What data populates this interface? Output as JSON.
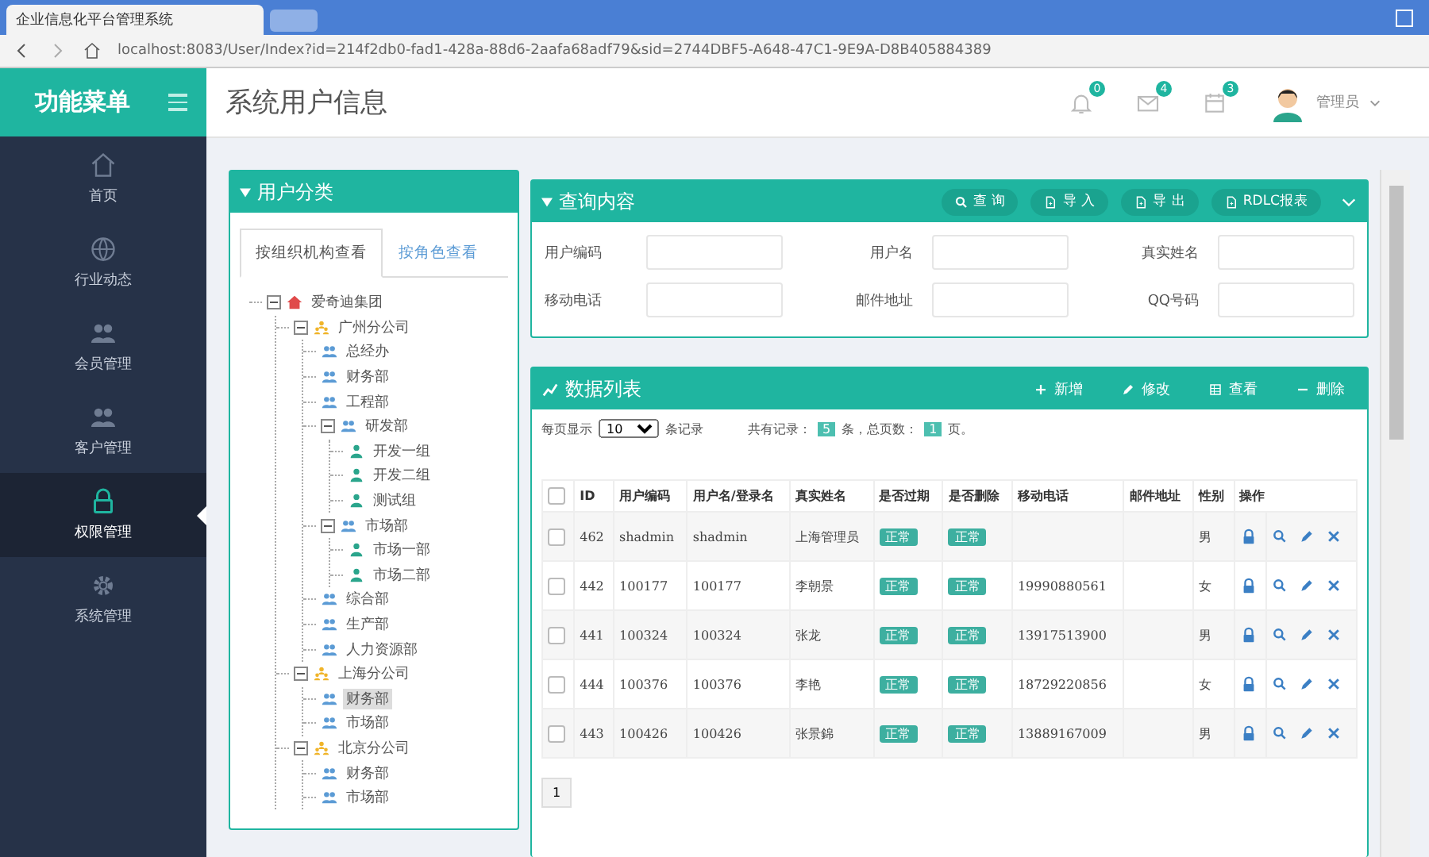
{
  "browser": {
    "tab_title": "企业信息化平台管理系统",
    "url": "localhost:8083/User/Index?id=214f2db0-fad1-428a-88d6-2aafa68adf79&sid=2744DBF5-A648-47C1-9E9A-D8B405884389"
  },
  "sidebar": {
    "title": "功能菜单",
    "items": [
      {
        "label": "首页",
        "selected": false
      },
      {
        "label": "行业动态",
        "selected": false
      },
      {
        "label": "会员管理",
        "selected": false
      },
      {
        "label": "客户管理",
        "selected": false
      },
      {
        "label": "权限管理",
        "selected": true
      },
      {
        "label": "系统管理",
        "selected": false
      }
    ]
  },
  "header": {
    "title": "系统用户信息",
    "notifications": [
      {
        "count": "0"
      },
      {
        "count": "4"
      },
      {
        "count": "3"
      }
    ],
    "user": "管理员"
  },
  "category_panel": {
    "title": "用户分类",
    "tabs": [
      {
        "label": "按组织机构查看",
        "selected": true
      },
      {
        "label": "按角色查看",
        "selected": false
      }
    ],
    "tree": [
      {
        "label": "爱奇迪集团",
        "kind": "root",
        "expanded": true,
        "selected": false,
        "children": [
          {
            "label": "广州分公司",
            "kind": "company",
            "expanded": true,
            "selected": false,
            "children": [
              {
                "label": "总经办",
                "kind": "dept",
                "selected": false
              },
              {
                "label": "财务部",
                "kind": "dept",
                "selected": false
              },
              {
                "label": "工程部",
                "kind": "dept",
                "selected": false
              },
              {
                "label": "研发部",
                "kind": "dept",
                "expanded": true,
                "selected": false,
                "children": [
                  {
                    "label": "开发一组",
                    "kind": "group",
                    "selected": false
                  },
                  {
                    "label": "开发二组",
                    "kind": "group",
                    "selected": false
                  },
                  {
                    "label": "测试组",
                    "kind": "group",
                    "selected": false
                  }
                ]
              },
              {
                "label": "市场部",
                "kind": "dept",
                "expanded": true,
                "selected": false,
                "children": [
                  {
                    "label": "市场一部",
                    "kind": "group",
                    "selected": false
                  },
                  {
                    "label": "市场二部",
                    "kind": "group",
                    "selected": false
                  }
                ]
              },
              {
                "label": "综合部",
                "kind": "dept",
                "selected": false
              },
              {
                "label": "生产部",
                "kind": "dept",
                "selected": false
              },
              {
                "label": "人力资源部",
                "kind": "dept",
                "selected": false
              }
            ]
          },
          {
            "label": "上海分公司",
            "kind": "company",
            "expanded": true,
            "selected": false,
            "children": [
              {
                "label": "财务部",
                "kind": "dept",
                "selected": true
              },
              {
                "label": "市场部",
                "kind": "dept",
                "selected": false
              }
            ]
          },
          {
            "label": "北京分公司",
            "kind": "company",
            "expanded": true,
            "selected": false,
            "children": [
              {
                "label": "财务部",
                "kind": "dept",
                "selected": false
              },
              {
                "label": "市场部",
                "kind": "dept",
                "selected": false
              }
            ]
          }
        ]
      }
    ]
  },
  "query_panel": {
    "title": "查询内容",
    "buttons": [
      {
        "label": "查 询"
      },
      {
        "label": "导 入"
      },
      {
        "label": "导 出"
      },
      {
        "label": "RDLC报表"
      }
    ],
    "fields": [
      {
        "label": "用户编码"
      },
      {
        "label": "用户名"
      },
      {
        "label": "真实姓名"
      },
      {
        "label": "移动电话"
      },
      {
        "label": "邮件地址"
      },
      {
        "label": "QQ号码"
      }
    ]
  },
  "data_panel": {
    "title": "数据列表",
    "buttons": [
      {
        "label": "新增"
      },
      {
        "label": "修改"
      },
      {
        "label": "查看"
      },
      {
        "label": "删除"
      }
    ],
    "all_checked": false,
    "page_size_label": "每页显示",
    "page_size": "10",
    "records_label": "条记录",
    "total_label": "共有记录：",
    "total": "5",
    "total_unit": "条，总页数：",
    "pages": "1",
    "pages_unit": "页。",
    "columns": [
      "ID",
      "用户编码",
      "用户名/登录名",
      "真实姓名",
      "是否过期",
      "是否删除",
      "移动电话",
      "邮件地址",
      "性别",
      "操作"
    ],
    "rows": [
      {
        "checked": false,
        "cells": [
          "462",
          "shadmin",
          "shadmin",
          "上海管理员",
          "正常",
          "正常",
          "",
          "",
          "男"
        ]
      },
      {
        "checked": false,
        "cells": [
          "442",
          "100177",
          "100177",
          "李朝景",
          "正常",
          "正常",
          "19990880561",
          "",
          "女"
        ]
      },
      {
        "checked": false,
        "cells": [
          "441",
          "100324",
          "100324",
          "张龙",
          "正常",
          "正常",
          "13917513900",
          "",
          "男"
        ]
      },
      {
        "checked": false,
        "cells": [
          "444",
          "100376",
          "100376",
          "李艳",
          "正常",
          "正常",
          "18729220856",
          "",
          "女"
        ]
      },
      {
        "checked": false,
        "cells": [
          "443",
          "100426",
          "100426",
          "张景錦",
          "正常",
          "正常",
          "13889167009",
          "",
          "男"
        ]
      }
    ],
    "pagination": [
      {
        "label": "1"
      }
    ]
  }
}
